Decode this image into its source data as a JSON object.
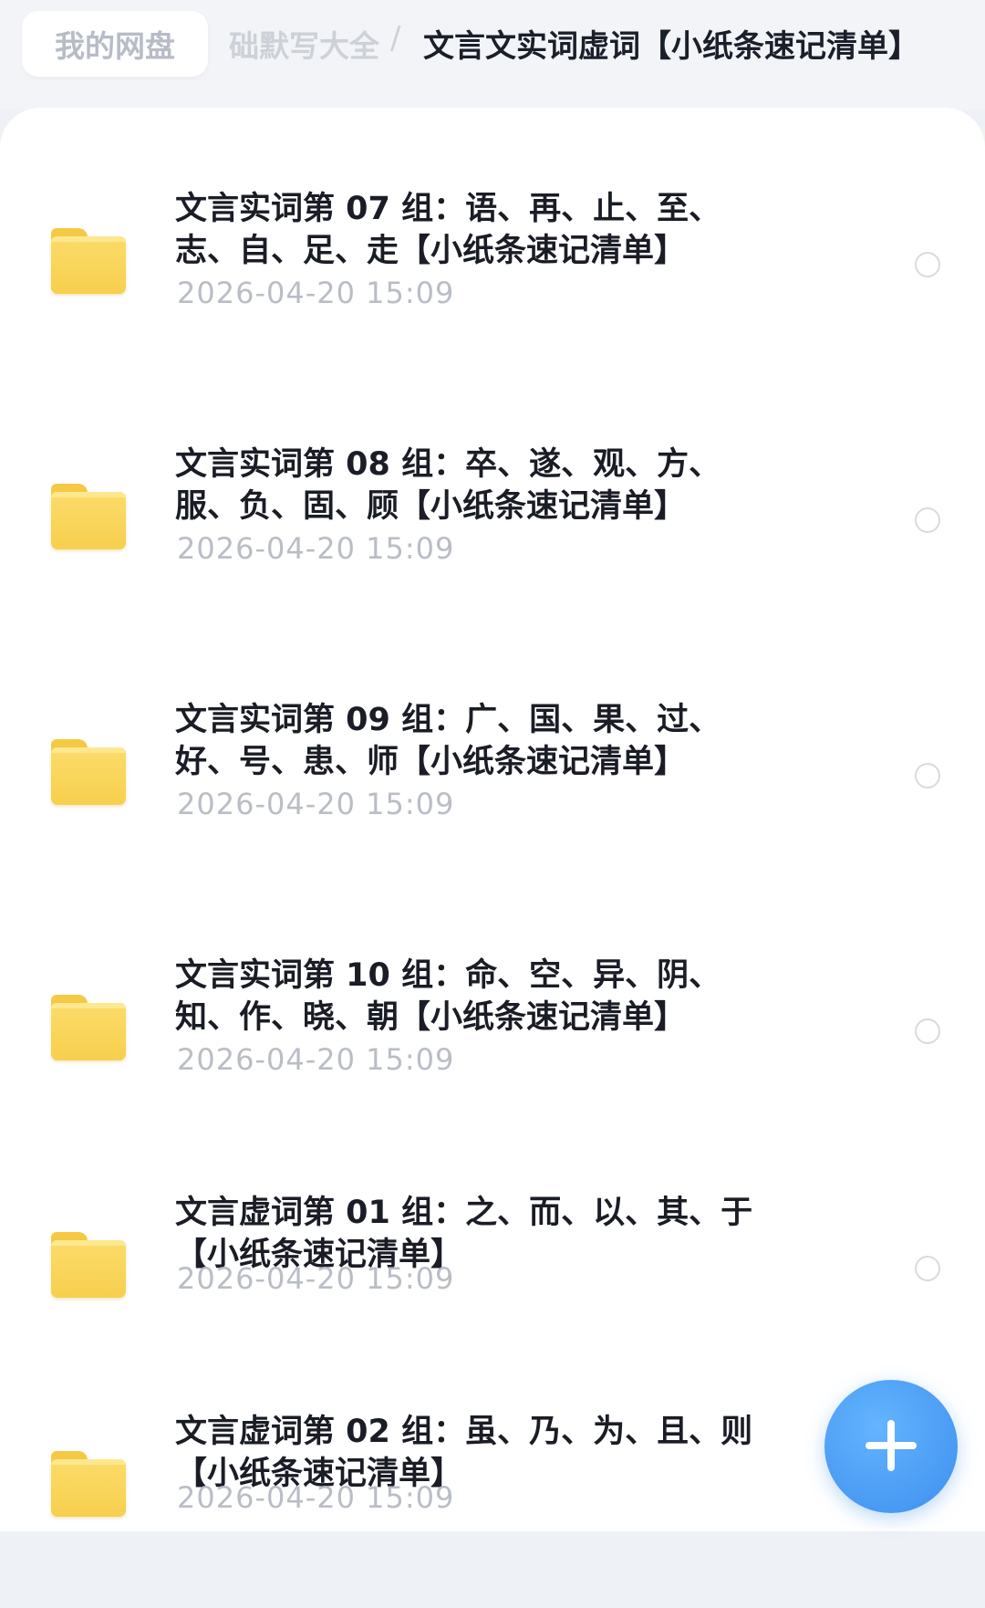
{
  "breadcrumb": {
    "home": "我的网盘",
    "parent_fragment": "础默写大全",
    "separator": "/",
    "current": "文言文实词虚词【小纸条速记清单】"
  },
  "items": [
    {
      "title_line1": "文言实词第 07 组：语、再、止、至、",
      "title_line2": "志、自、足、走【小纸条速记清单】",
      "date": "2026-04-20 15:09",
      "icon": "folder-icon"
    },
    {
      "title_line1": "文言实词第 08 组：卒、遂、观、方、",
      "title_line2": "服、负、固、顾【小纸条速记清单】",
      "date": "2026-04-20 15:09",
      "icon": "folder-icon"
    },
    {
      "title_line1": "文言实词第 09 组：广、国、果、过、",
      "title_line2": "好、号、患、师【小纸条速记清单】",
      "date": "2026-04-20 15:09",
      "icon": "folder-icon"
    },
    {
      "title_line1": "文言实词第 10 组：命、空、异、阴、",
      "title_line2": "知、作、晓、朝【小纸条速记清单】",
      "date": "2026-04-20 15:09",
      "icon": "folder-icon"
    },
    {
      "title_line1": "文言虚词第 01 组：之、而、以、其、于",
      "title_line2": "【小纸条速记清单】",
      "date": "2026-04-20 15:09",
      "icon": "folder-icon"
    },
    {
      "title_line1": "文言虚词第 02 组：虽、乃、为、且、则",
      "title_line2": "【小纸条速记清单】",
      "date": "2026-04-20 15:09",
      "icon": "folder-icon"
    }
  ],
  "fab": {
    "icon": "plus-icon",
    "color": "#3d8fee"
  },
  "colors": {
    "folder": "#f7cf4e",
    "date_text": "#b9bdc6",
    "title_text": "#1a1d26"
  }
}
